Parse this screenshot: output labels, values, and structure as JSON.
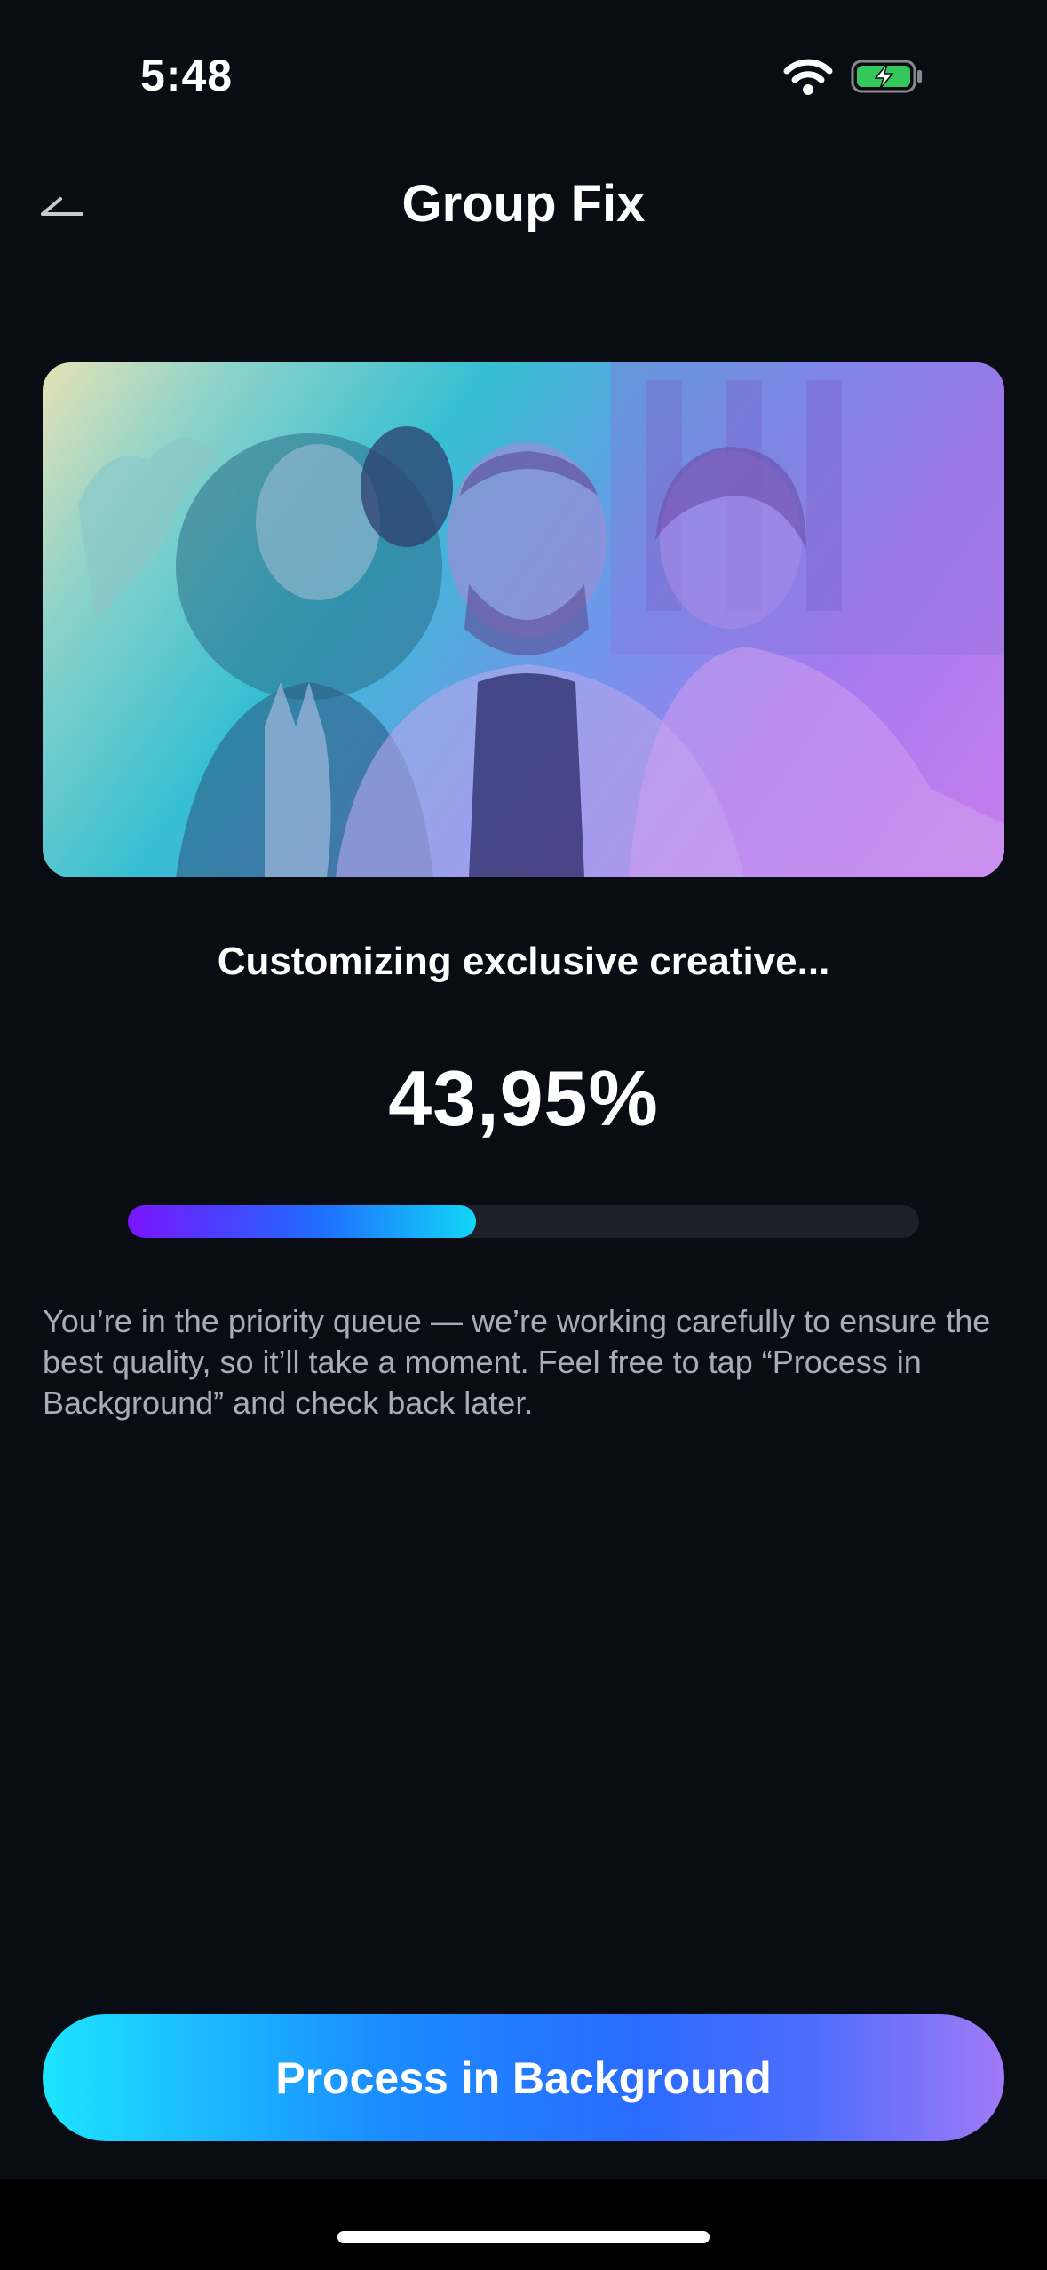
{
  "status_bar": {
    "time": "5:48",
    "wifi_icon": "wifi-icon",
    "battery_icon": "battery-charging-icon"
  },
  "header": {
    "back_icon": "back-arrow-icon",
    "title": "Group Fix"
  },
  "preview": {
    "icon": "group-selfie-photo"
  },
  "progress": {
    "status": "Customizing exclusive creative...",
    "percent_label": "43,95%",
    "value": 0.4395
  },
  "description": "You’re in the priority queue — we’re working carefully to ensure the best quality, so it’ll take a moment. Feel free to tap “Process in Background” and check back later.",
  "cta": {
    "label": "Process in Background"
  },
  "colors": {
    "background": "#0a0c14",
    "track": "#1e2029",
    "accent_cyan": "#1de4ff",
    "accent_purple": "#a07af6"
  }
}
